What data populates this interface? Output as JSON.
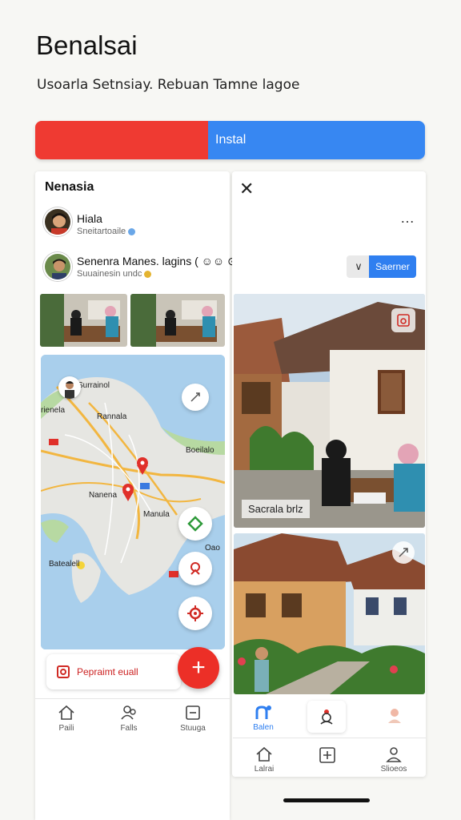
{
  "header": {
    "title": "Benalsai",
    "subtitle": "Usoarla Setnsiay. Rebuan Tamne lagoe",
    "install_label": "Instal"
  },
  "left_panel": {
    "title": "Nenasia",
    "users": [
      {
        "name": "Hiala",
        "sub": "Sneitartoaile"
      },
      {
        "name": "Senenra Manes. lagins ( ☺☺ ⊙ Fallble)",
        "sub": "Suuainesin undc"
      }
    ],
    "map_labels": [
      "Surrainol",
      "rienela",
      "Rannala",
      "Boeilalo",
      "Manula",
      "Nanena",
      "Batealell",
      "Oao"
    ],
    "report_label": "Pepraimt euall",
    "add_label": "+",
    "nav": [
      {
        "icon": "home-icon",
        "label": "Paili"
      },
      {
        "icon": "people-icon",
        "label": "Falls"
      },
      {
        "icon": "minus-box-icon",
        "label": "Stuuga"
      }
    ]
  },
  "right_panel": {
    "close_label": "✕",
    "more_label": "…",
    "chevron_label": "∨",
    "submit_label": "Saerner",
    "photo_caption": "Sacrala brlz",
    "nav_top": [
      {
        "icon": "location-icon",
        "label": "Balen"
      },
      {
        "icon": "pin-people-icon",
        "label": ""
      },
      {
        "icon": "user-icon",
        "label": ""
      }
    ],
    "nav_bottom": [
      {
        "icon": "home-icon",
        "label": "Lalrai"
      },
      {
        "icon": "plus-box-icon",
        "label": ""
      },
      {
        "icon": "person-icon",
        "label": "Slioeos"
      }
    ]
  },
  "colors": {
    "accent_red": "#ef3a32",
    "accent_blue": "#3787f2"
  }
}
